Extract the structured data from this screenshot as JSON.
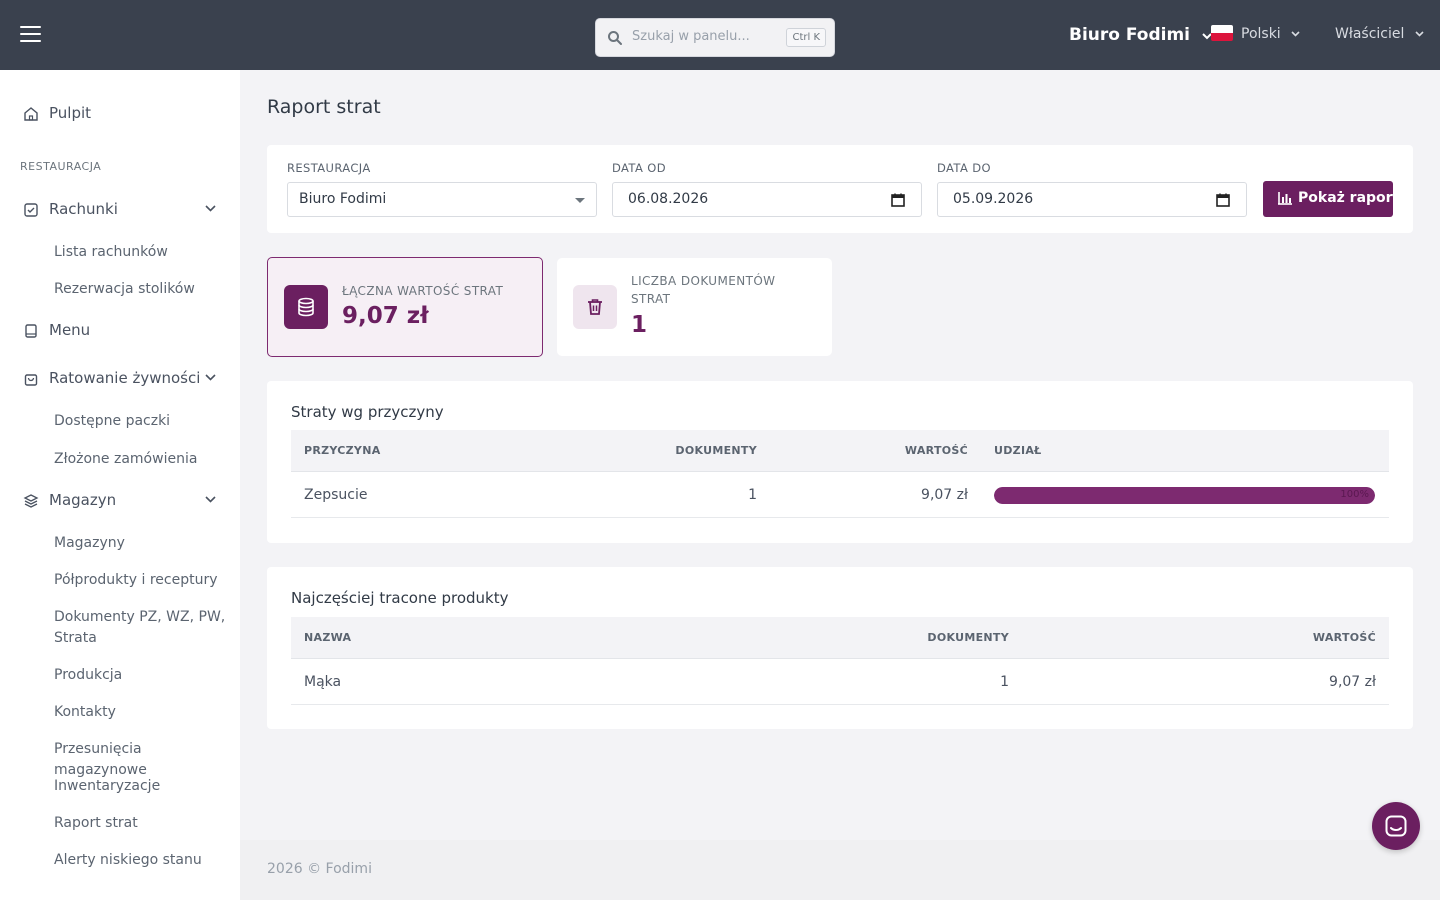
{
  "topbar": {
    "search_placeholder": "Szukaj w panelu...",
    "search_shortcut": "Ctrl K",
    "organization": "Biuro Fodimi",
    "language": "Polski",
    "user_role": "Właściciel"
  },
  "sidebar": {
    "dashboard": "Pulpit",
    "section_title": "RESTAURACJA",
    "bills": "Rachunki",
    "bills_sub": [
      "Lista rachunków",
      "Rezerwacja stolików"
    ],
    "menu": "Menu",
    "food_rescue": "Ratowanie żywności",
    "food_rescue_sub": [
      "Dostępne paczki",
      "Złożone zamówienia"
    ],
    "warehouse": "Magazyn",
    "warehouse_sub": [
      "Magazyny",
      "Półprodukty i receptury",
      "Dokumenty PZ, WZ, PW, Strata",
      "Produkcja",
      "Kontakty",
      "Przesunięcia magazynowe",
      "Inwentaryzacje",
      "Raport strat",
      "Alerty niskiego stanu"
    ]
  },
  "page": {
    "title": "Raport strat"
  },
  "filters": {
    "restaurant_label": "RESTAURACJA",
    "restaurant_value": "Biuro Fodimi",
    "date_from_label": "DATA OD",
    "date_from_value": "06.08.2026",
    "date_to_label": "DATA DO",
    "date_to_value": "05.09.2026",
    "submit_label": "Pokaż raport"
  },
  "stats": {
    "total_label": "ŁĄCZNA WARTOŚĆ STRAT",
    "total_value": "9,07 zł",
    "docs_label_line1": "LICZBA DOKUMENTÓW",
    "docs_label_line2": "STRAT",
    "docs_value": "1"
  },
  "by_reason": {
    "title": "Straty wg przyczyny",
    "columns": [
      "PRZYCZYNA",
      "DOKUMENTY",
      "WARTOŚĆ",
      "UDZIAŁ"
    ],
    "rows": [
      {
        "reason": "Zepsucie",
        "documents": "1",
        "value": "9,07 zł",
        "share_label": "100%",
        "share": 100
      }
    ]
  },
  "top_products": {
    "title": "Najczęściej tracone produkty",
    "columns": [
      "NAZWA",
      "DOKUMENTY",
      "WARTOŚĆ"
    ],
    "rows": [
      {
        "name": "Mąka",
        "documents": "1",
        "value": "9,07 zł"
      }
    ]
  },
  "footer": {
    "text": "2026 © Fodimi"
  },
  "colors": {
    "topbar": "#3a414e",
    "accent": "#6b1f60",
    "progress": "#7d2a70"
  }
}
